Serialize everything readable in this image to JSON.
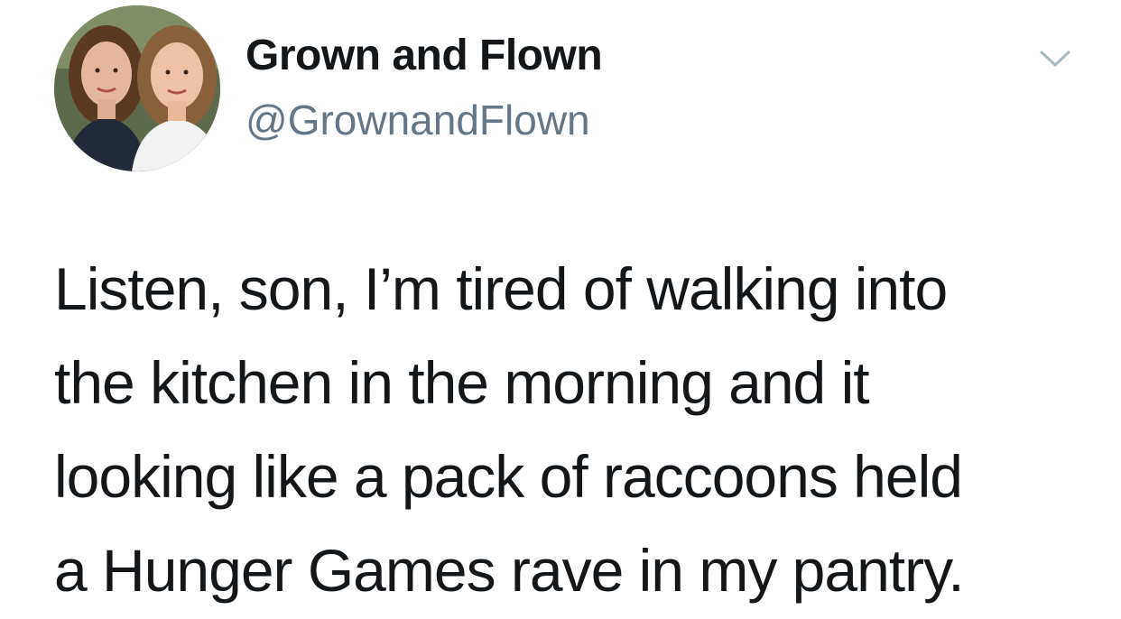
{
  "author": {
    "display_name": "Grown and Flown",
    "handle": "@GrownandFlown",
    "avatar_icon": "profile-photo"
  },
  "menu": {
    "icon": "chevron-down-icon"
  },
  "tweet": {
    "lines": [
      "Listen, son, I’m tired of walking into",
      "the kitchen in the morning and it",
      "looking like a pack of raccoons held",
      "a Hunger Games rave in my pantry."
    ]
  },
  "colors": {
    "text": "#14171a",
    "secondary": "#657786",
    "chevron": "#aab8c2",
    "background": "#ffffff"
  }
}
